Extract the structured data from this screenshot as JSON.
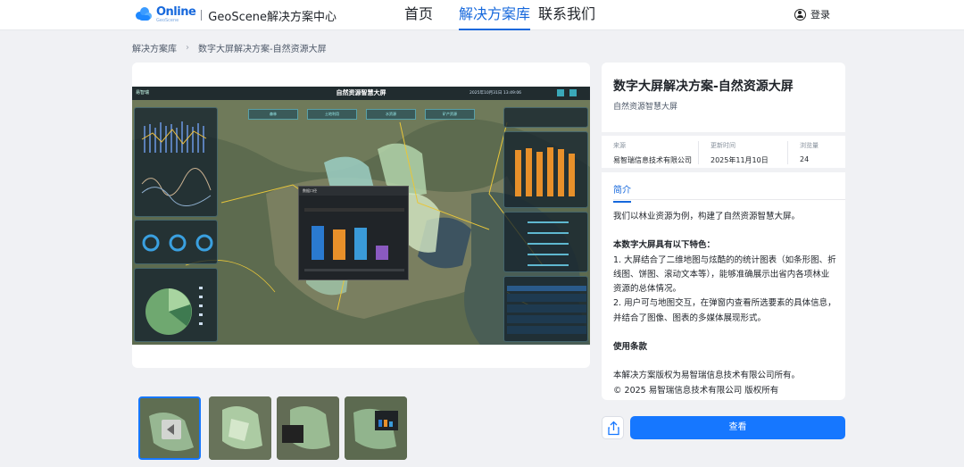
{
  "header": {
    "logo_text": "Online",
    "logo_subtext": "GeoScene",
    "site_title": "GeoScene解决方案中心",
    "nav": [
      {
        "label": "首页",
        "active": false
      },
      {
        "label": "解决方案库",
        "active": true
      },
      {
        "label": "联系我们",
        "active": false
      }
    ],
    "login_label": "登录"
  },
  "breadcrumb": {
    "items": [
      "解决方案库",
      "数字大屏解决方案-自然资源大屏"
    ]
  },
  "preview": {
    "dashboard_title": "自然资源智慧大屏",
    "dashboard_logo": "易智瑞",
    "dashboard_date": "2025年10月31日  13:49:06",
    "tabs": [
      "森林",
      "土地利用",
      "水资源",
      "矿产资源"
    ],
    "popup_title": "数据口径"
  },
  "info": {
    "title": "数字大屏解决方案-自然资源大屏",
    "subtitle": "自然资源智慧大屏",
    "meta": [
      {
        "label": "来源",
        "value": "易智瑞信息技术有限公司"
      },
      {
        "label": "更新时间",
        "value": "2025年11月10日"
      },
      {
        "label": "浏览量",
        "value": "24"
      }
    ]
  },
  "intro": {
    "tab_label": "简介",
    "para1": "我们以林业资源为例，构建了自然资源智慧大屏。",
    "features_heading": "本数字大屏具有以下特色：",
    "feature1": "1. 大屏结合了二维地图与炫酷的的统计图表（如条形图、折线图、饼图、滚动文本等），能够准确展示出省内各项林业资源的总体情况。",
    "feature2": "2. 用户可与地图交互，在弹窗内查看所选要素的具体信息，并结合了图像、图表的多媒体展现形式。",
    "terms_heading": "使用条款",
    "terms1": "本解决方案版权为易智瑞信息技术有限公司所有。",
    "terms2": "© 2025 易智瑞信息技术有限公司 版权所有"
  },
  "actions": {
    "view_label": "查看",
    "share_icon": "share-icon"
  },
  "colors": {
    "accent": "#1677ff",
    "background": "#f0f1f4"
  }
}
